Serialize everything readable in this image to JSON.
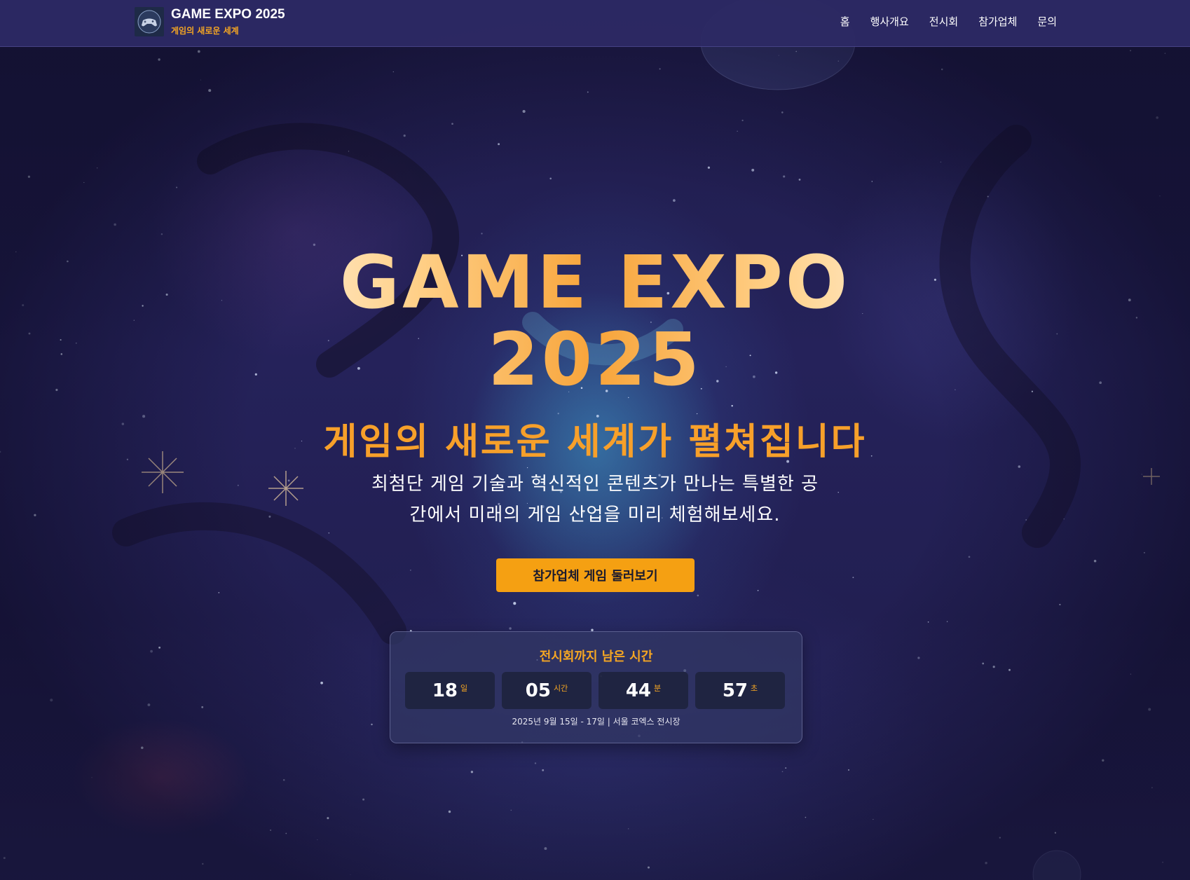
{
  "header": {
    "brand_title": "GAME EXPO 2025",
    "brand_subtitle": "게임의 새로운 세계",
    "logo_icon": "gamepad-logo-icon",
    "nav": [
      {
        "label": "홈"
      },
      {
        "label": "행사개요"
      },
      {
        "label": "전시회"
      },
      {
        "label": "참가업체"
      },
      {
        "label": "문의"
      }
    ]
  },
  "hero": {
    "title_line1": "GAME EXPO",
    "title_line2": "2025",
    "subtitle": "게임의 새로운 세계가 펼쳐집니다",
    "description_line1": "최첨단 게임 기술과 혁신적인 콘텐츠가 만나는 특별한 공",
    "description_line2": "간에서 미래의 게임 산업을 미리 체험해보세요.",
    "cta_label": "참가업체 게임 둘러보기"
  },
  "countdown": {
    "title": "전시회까지 남은 시간",
    "units": [
      {
        "value": "18",
        "label": "일"
      },
      {
        "value": "05",
        "label": "시간"
      },
      {
        "value": "44",
        "label": "분"
      },
      {
        "value": "57",
        "label": "초"
      }
    ],
    "info": "2025년 9월 15일 - 17일 | 서울 코엑스 전시장"
  },
  "colors": {
    "accent": "#f5a623",
    "header_bg": "#2d2a64",
    "cta_bg": "#f5a012"
  }
}
